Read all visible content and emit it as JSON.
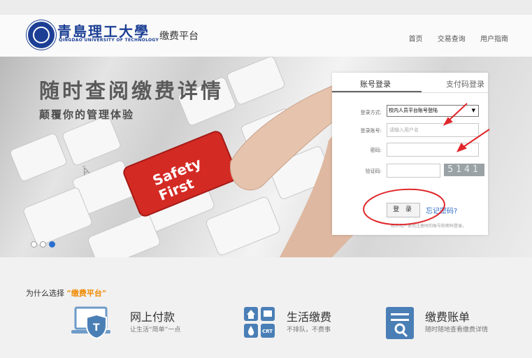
{
  "header": {
    "school_name_cn": "青島理工大學",
    "school_name_en": "QINGDAO UNIVERSITY OF TECHNOLOGY",
    "site_title": "缴费平台",
    "nav": [
      "首页",
      "交易查询",
      "用户指南"
    ]
  },
  "banner": {
    "headline": "随时查阅缴费详情",
    "subline": "颠覆你的管理体验",
    "key_text_1": "Safety",
    "key_text_2": "First",
    "slides": 3,
    "active_slide": 3
  },
  "login": {
    "tabs": [
      "账号登录",
      "支付码登录"
    ],
    "active_tab": "账号登录",
    "method_label": "登录方式:",
    "method_value": "校内人员平台账号登陆",
    "account_label": "登录账号:",
    "account_placeholder": "请输入用户名",
    "password_label": "密码:",
    "captcha_label": "验证码:",
    "captcha_text": "5141",
    "login_button": "登 录",
    "forgot_link": "忘记密码?",
    "note": "校外用户使用注册时的账号和密码登录。"
  },
  "why": {
    "prefix": "为什么选择",
    "highlight": "“缴费平台”"
  },
  "features": [
    {
      "title": "网上付款",
      "subtitle": "让生活“简单”一点",
      "icon": "laptop-shield-icon"
    },
    {
      "title": "生活缴费",
      "subtitle": "不排队，不费事",
      "icon": "utility-bills-icon"
    },
    {
      "title": "缴费账单",
      "subtitle": "随时随地查看缴费详情",
      "icon": "bill-search-icon"
    }
  ],
  "colors": {
    "brand_blue": "#1c3f95",
    "highlight_orange": "#f08a00",
    "key_red": "#d42a24",
    "annotation_red": "#e0262a"
  }
}
